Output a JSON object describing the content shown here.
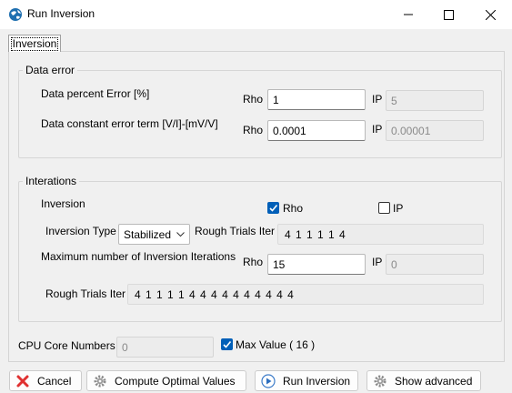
{
  "window": {
    "title": "Run Inversion"
  },
  "tabs": [
    "Inversion"
  ],
  "data_error": {
    "title": "Data error",
    "percent_label": "Data percent Error [%]",
    "constant_label": "Data constant error term [V/I]-[mV/V]",
    "rho_label": "Rho",
    "ip_label": "IP",
    "percent_rho": "1",
    "percent_ip": "5",
    "constant_rho": "0.0001",
    "constant_ip": "0.00001"
  },
  "iterations": {
    "title": "Interations",
    "inversion_label": "Inversion",
    "rho_checkbox": "Rho",
    "ip_checkbox": "IP",
    "rho_checked": true,
    "ip_checked": false,
    "type_label": "Inversion Type",
    "type_value": "Stabilized",
    "rough_label": "Rough Trials Iter",
    "rough_value": "4 1 1 1 1 4",
    "max_label": "Maximum number of Inversion Iterations",
    "rho_label": "Rho",
    "ip_label": "IP",
    "max_rho": "15",
    "max_ip": "0",
    "rough2_label": "Rough Trials Iter",
    "rough2_value": "4 1 1 1 1 4 4 4 4 4 4 4 4 4 4"
  },
  "cpu": {
    "label": "CPU Core Numbers",
    "value": "0",
    "max_checkbox": "Max Value ( 16 )",
    "max_checked": true
  },
  "buttons": {
    "cancel": "Cancel",
    "compute": "Compute Optimal Values",
    "run": "Run Inversion",
    "advanced": "Show advanced"
  },
  "colors": {
    "accent": "#005fb8",
    "cancel_icon": "#e03131"
  }
}
